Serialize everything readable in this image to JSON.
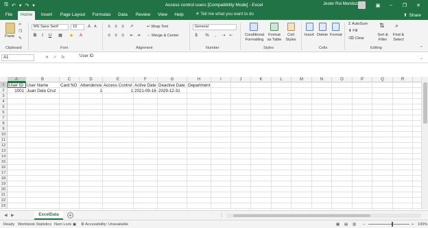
{
  "titlebar": {
    "title": "Access control users  [Compatibility Mode]  -  Excel",
    "user": "Jester Roi Mendoza",
    "autosave_icon": "save-icon",
    "undo_icon": "undo-icon",
    "redo_icon": "redo-icon",
    "accent": "#217346"
  },
  "menu": {
    "tabs": [
      "File",
      "Home",
      "Insert",
      "Page Layout",
      "Formulas",
      "Data",
      "Review",
      "View",
      "Help"
    ],
    "active": "Home",
    "tell_me": "Tell me what you want to do",
    "share": "Share"
  },
  "ribbon": {
    "clipboard": {
      "paste": "Paste",
      "label": "Clipboard"
    },
    "font": {
      "name": "MS Sans Serif",
      "size": "10",
      "label": "Font"
    },
    "alignment": {
      "wrap": "Wrap Text",
      "merge": "Merge & Center",
      "label": "Alignment"
    },
    "number": {
      "format": "General",
      "label": "Number"
    },
    "styles": {
      "conditional": "Conditional Formatting",
      "format_table": "Format as Table",
      "cell_styles": "Cell Styles",
      "label": "Styles"
    },
    "cells": {
      "insert": "Insert",
      "delete": "Delete",
      "format": "Format",
      "label": "Cells"
    },
    "editing": {
      "autosum": "AutoSum",
      "fill": "Fill",
      "clear": "Clear",
      "sort": "Sort & Filter",
      "find": "Find & Select",
      "label": "Editing"
    }
  },
  "formula_bar": {
    "namebox": "A1",
    "formula": "'User ID"
  },
  "grid": {
    "columns": [
      "A",
      "B",
      "C",
      "D",
      "E",
      "F",
      "G",
      "H",
      "I",
      "J",
      "K",
      "L",
      "M",
      "N",
      "O",
      "P",
      "Q",
      "R"
    ],
    "rows": [
      "1",
      "2",
      "3",
      "4",
      "5",
      "6",
      "7",
      "8",
      "9",
      "10",
      "11",
      "12",
      "13",
      "14",
      "15",
      "16",
      "17",
      "18",
      "19",
      "20",
      "21",
      "22",
      "23"
    ],
    "headers": [
      "User ID",
      "User Name",
      "Card NO",
      "Attendence",
      "Access Control",
      "Active Date",
      "Deactive Date",
      "Department"
    ],
    "row2": {
      "A": "1001",
      "B": "Juan  Dela Cruz",
      "D": "1",
      "E": "1",
      "F": "2021-09-16",
      "G": "2029-12-31"
    }
  },
  "sheets": {
    "tabs": [
      "ExcelData"
    ],
    "active": "ExcelData"
  },
  "status": {
    "ready": "Ready",
    "workbook_statistics": "Workbook Statistics",
    "num_lock": "Num Lock",
    "accessibility": "Accessibility: Unavailable",
    "zoom": "100%"
  }
}
